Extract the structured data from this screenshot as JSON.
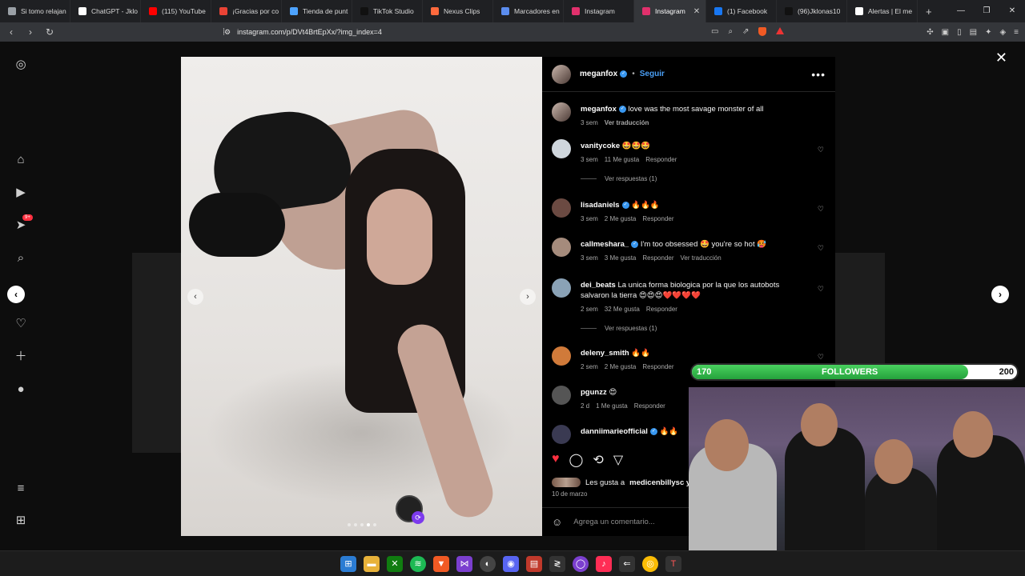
{
  "browser": {
    "tabs": [
      {
        "label": "Si tomo relajan",
        "color": "#9aa0a6"
      },
      {
        "label": "ChatGPT - Jklo",
        "color": "#ffffff"
      },
      {
        "label": "(115) YouTube",
        "color": "#ff0000"
      },
      {
        "label": "¡Gracias por co",
        "color": "#ea4335"
      },
      {
        "label": "Tienda de punt",
        "color": "#4da3ff"
      },
      {
        "label": "TikTok Studio",
        "color": "#111111"
      },
      {
        "label": "Nexus Clips",
        "color": "#ff6a3d"
      },
      {
        "label": "Marcadores en",
        "color": "#5b8def"
      },
      {
        "label": "Instagram",
        "color": "#e1306c"
      },
      {
        "label": "Instagram",
        "color": "#e1306c",
        "active": true
      },
      {
        "label": "(1) Facebook",
        "color": "#1877f2"
      },
      {
        "label": "(96)Jklonas10",
        "color": "#111111"
      },
      {
        "label": "Alertas | El me",
        "color": "#ffffff"
      }
    ],
    "url": "instagram.com/p/DVt4BrtEpXx/?img_index=4"
  },
  "post": {
    "author": "meganfox",
    "follow_label": "Seguir",
    "caption": "love was the most savage monster of all",
    "caption_time": "3 sem",
    "translate_label": "Ver traducción",
    "likes_prefix": "Les gusta a",
    "likes_user": "medicenbillysc y",
    "date": "10 de marzo",
    "add_comment_placeholder": "Agrega un comentario...",
    "photo_dots": 5,
    "photo_active_dot": 3
  },
  "comments": [
    {
      "user": "vanitycoke",
      "text": "🤩🤩🤩",
      "time": "3 sem",
      "likes": "11 Me gusta",
      "reply": "Responder",
      "replies": "Ver respuestas (1)"
    },
    {
      "user": "lisadaniels",
      "verified": true,
      "text": "🔥🔥🔥",
      "time": "3 sem",
      "likes": "2 Me gusta",
      "reply": "Responder"
    },
    {
      "user": "callmeshara_",
      "verified": true,
      "text": "I'm too obsessed 🤩 you're so hot 🥵",
      "time": "3 sem",
      "likes": "3 Me gusta",
      "reply": "Responder",
      "translate": "Ver traducción"
    },
    {
      "user": "dei_beats",
      "text": "La unica forma biologica por la que los autobots salvaron la tierra 😍😍😍❤️❤️❤️❤️",
      "time": "2 sem",
      "likes": "32 Me gusta",
      "reply": "Responder",
      "replies": "Ver respuestas (1)"
    },
    {
      "user": "deleny_smith",
      "text": "🔥🔥",
      "time": "2 sem",
      "likes": "2 Me gusta",
      "reply": "Responder"
    },
    {
      "user": "pgunzz",
      "text": "😍",
      "time": "2 d",
      "likes": "1 Me gusta",
      "reply": "Responder"
    },
    {
      "user": "danniimarieofficial",
      "verified": true,
      "text": "🔥🔥",
      "time": "",
      "likes": "",
      "reply": ""
    }
  ],
  "overlay": {
    "followers_label": "FOLLOWERS",
    "current": "170",
    "goal": "200",
    "progress": 0.85
  }
}
